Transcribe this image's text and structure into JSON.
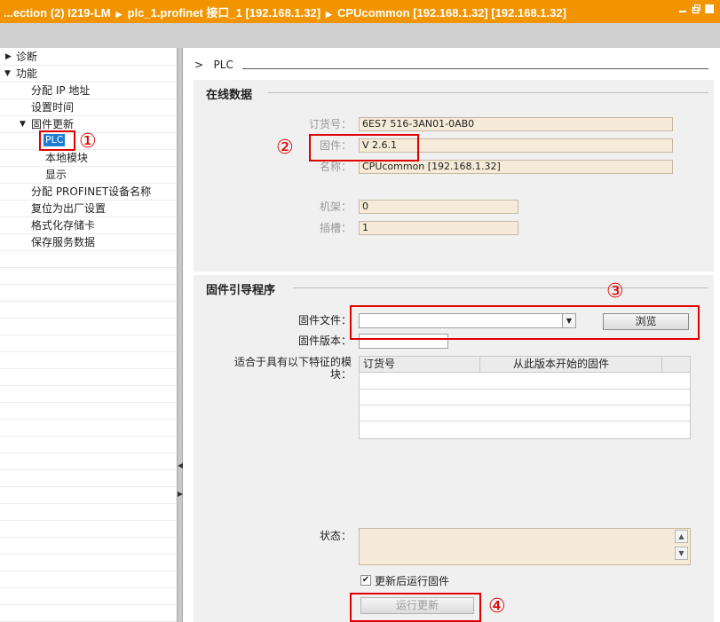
{
  "titlebar": {
    "crumbs": [
      "...ection (2) I219-LM",
      "plc_1.profinet 接口_1 [192.168.1.32]",
      "CPUcommon [192.168.1.32] [192.168.1.32]"
    ]
  },
  "tree": {
    "diagnose": "诊断",
    "functions": "功能",
    "assign_ip": "分配 IP 地址",
    "set_time": "设置时间",
    "firmware_update": "固件更新",
    "plc": "PLC",
    "local_module": "本地模块",
    "display": "显示",
    "assign_profinet_name": "分配 PROFINET设备名称",
    "reset_factory": "复位为出厂设置",
    "format_card": "格式化存储卡",
    "save_service_data": "保存服务数据"
  },
  "breadcrumb": {
    "arrow": ">",
    "label": "PLC"
  },
  "online_data": {
    "title": "在线数据",
    "order_no_label": "订货号：",
    "order_no": "6ES7 516-3AN01-0AB0",
    "firmware_label": "固件：",
    "firmware": "V 2.6.1",
    "name_label": "名称：",
    "name": "CPUcommon [192.168.1.32]",
    "rack_label": "机架：",
    "rack": "0",
    "slot_label": "插槽：",
    "slot": "1"
  },
  "loader": {
    "title": "固件引导程序",
    "file_label": "固件文件：",
    "file_value": "",
    "browse": "浏览",
    "version_label": "固件版本：",
    "version_value": "",
    "suitable_label": "适合于具有以下特征的模块：",
    "table_headers": [
      "订货号",
      "从此版本开始的固件"
    ],
    "status_label": "状态：",
    "status_value": "",
    "run_after_update": "更新后运行固件",
    "run_after_update_checked": true,
    "run_update": "运行更新"
  },
  "annotations": [
    "①",
    "②",
    "③",
    "④"
  ],
  "colors": {
    "accent": "#f29400",
    "annotation": "#e00000",
    "selection": "#1e7bd6"
  },
  "icons": [
    "collapse-triangle-icon",
    "expand-triangle-icon",
    "breadcrumb-arrow-icon",
    "dropdown-arrow-icon",
    "scroll-up-icon",
    "scroll-down-icon",
    "checkbox-checked-icon",
    "minimize-icon",
    "restore-icon",
    "close-icon"
  ]
}
